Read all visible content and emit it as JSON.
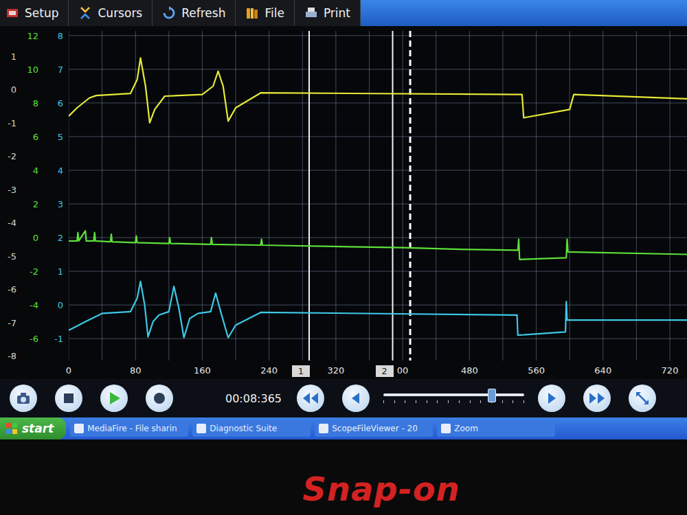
{
  "toolbar": [
    {
      "label": "Setup"
    },
    {
      "label": "Cursors"
    },
    {
      "label": "Refresh"
    },
    {
      "label": "File"
    },
    {
      "label": "Print"
    }
  ],
  "chart": {
    "axes": [
      {
        "color": "#d8d8c8",
        "ticks": [
          "1",
          "0",
          "-1",
          "-2",
          "-3",
          "-4",
          "-5",
          "-6",
          "-7",
          "-8"
        ]
      },
      {
        "color": "#5de03a",
        "ticks": [
          "12",
          "10",
          "8",
          "6",
          "4",
          "2",
          "0",
          "-2",
          "-4",
          "-6"
        ]
      },
      {
        "color": "#3ec8e8",
        "ticks": [
          "8",
          "7",
          "6",
          "5",
          "4",
          "3",
          "2",
          "1",
          "0",
          "-1"
        ]
      }
    ],
    "x_ticks": [
      {
        "t": 0,
        "label": "0"
      },
      {
        "t": 80,
        "label": "80"
      },
      {
        "t": 160,
        "label": "160"
      },
      {
        "t": 240,
        "label": "240"
      },
      {
        "t": 320,
        "label": "320"
      },
      {
        "t": 400,
        "label": "00"
      },
      {
        "t": 480,
        "label": "480"
      },
      {
        "t": 560,
        "label": "560"
      },
      {
        "t": 640,
        "label": "640"
      },
      {
        "t": 720,
        "label": "720"
      }
    ],
    "cursors": [
      {
        "label": "1",
        "t": 288
      },
      {
        "label": "2",
        "t": 388
      }
    ],
    "marker": {
      "t": 409
    },
    "series": [
      {
        "color": "#e8e838",
        "axis": 0,
        "t": [
          0,
          10,
          25,
          33,
          74,
          82,
          86,
          92,
          97,
          103,
          115,
          160,
          173,
          179,
          185,
          191,
          200,
          230,
          543,
          545,
          600,
          605,
          741
        ],
        "v": [
          -0.8,
          -0.55,
          -0.25,
          -0.18,
          -0.12,
          0.3,
          0.95,
          0.1,
          -1.0,
          -0.6,
          -0.2,
          -0.15,
          0.1,
          0.55,
          0.1,
          -0.95,
          -0.55,
          -0.1,
          -0.15,
          -0.85,
          -0.6,
          -0.15,
          -0.28
        ]
      },
      {
        "color": "#5de03a",
        "axis": 1,
        "t": [
          0,
          10,
          11,
          12,
          20,
          21,
          30,
          31,
          32,
          50,
          51,
          52,
          80,
          81,
          82,
          120,
          121,
          122,
          170,
          171,
          172,
          230,
          231,
          232,
          400,
          470,
          538,
          539,
          540,
          596,
          597,
          598,
          741
        ],
        "v": [
          -0.2,
          -0.2,
          0.3,
          -0.2,
          0.4,
          -0.2,
          -0.2,
          0.3,
          -0.2,
          -0.25,
          0.2,
          -0.25,
          -0.3,
          0.1,
          -0.3,
          -0.35,
          0.0,
          -0.35,
          -0.4,
          0.0,
          -0.4,
          -0.45,
          -0.1,
          -0.45,
          -0.6,
          -0.7,
          -0.75,
          -0.1,
          -1.3,
          -1.2,
          -0.1,
          -0.85,
          -1.0
        ]
      },
      {
        "color": "#3ec8e8",
        "axis": 2,
        "t": [
          0,
          20,
          40,
          74,
          82,
          86,
          91,
          95,
          101,
          108,
          120,
          126,
          132,
          138,
          145,
          155,
          170,
          176,
          182,
          191,
          200,
          230,
          537,
          538,
          595,
          596,
          597,
          741
        ],
        "v": [
          -0.75,
          -0.5,
          -0.25,
          -0.2,
          0.2,
          0.7,
          0.0,
          -0.95,
          -0.5,
          -0.3,
          -0.2,
          0.55,
          -0.1,
          -0.97,
          -0.4,
          -0.25,
          -0.2,
          0.35,
          -0.2,
          -0.97,
          -0.6,
          -0.22,
          -0.3,
          -0.9,
          -0.8,
          0.1,
          -0.45,
          -0.45
        ]
      }
    ]
  },
  "playback": {
    "time": "00:08:365",
    "level": 0.77
  },
  "taskbar": {
    "start": "start",
    "items": [
      "MediaFire - File sharin",
      "Diagnostic Suite",
      "ScopeFileViewer - 20",
      "Zoom"
    ]
  },
  "brand": "Snap-on"
}
